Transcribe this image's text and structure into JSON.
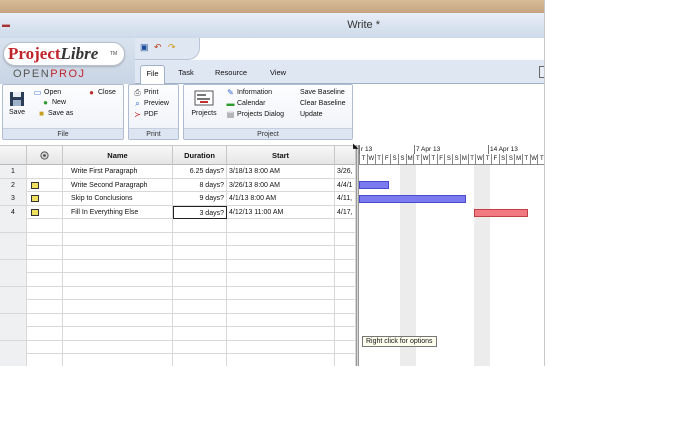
{
  "window": {
    "title": "Write *"
  },
  "logo": {
    "brand_project": "Project",
    "brand_libre": "Libre",
    "trademark": "TM",
    "openproj_open": "OPEN",
    "openproj_proj": "PROJ"
  },
  "tabs": [
    {
      "label": "File",
      "active": true
    },
    {
      "label": "Task",
      "active": false
    },
    {
      "label": "Resource",
      "active": false
    },
    {
      "label": "View",
      "active": false
    }
  ],
  "ribbon": {
    "file": {
      "caption": "File",
      "save": "Save",
      "open": "Open",
      "close": "Close",
      "new": "New",
      "save_as": "Save as"
    },
    "print": {
      "caption": "Print",
      "print": "Print",
      "preview": "Preview",
      "pdf": "PDF"
    },
    "project": {
      "caption": "Project",
      "projects": "Projects",
      "information": "Information",
      "calendar": "Calendar",
      "projects_dialog": "Projects Dialog",
      "save_baseline": "Save Baseline",
      "clear_baseline": "Clear Baseline",
      "update": "Update"
    }
  },
  "grid": {
    "headers": {
      "info": "",
      "name": "Name",
      "duration": "Duration",
      "start": "Start"
    },
    "rows": [
      {
        "num": "1",
        "note": false,
        "name": "Write First Paragraph",
        "duration": "6.25 days?",
        "start": "3/18/13 8:00 AM",
        "finish": "3/26,"
      },
      {
        "num": "2",
        "note": true,
        "name": "Write Second Paragraph",
        "duration": "8 days?",
        "start": "3/26/13 8:00 AM",
        "finish": "4/4/1"
      },
      {
        "num": "3",
        "note": true,
        "name": "Skip to Conclusions",
        "duration": "9 days?",
        "start": "4/1/13 8:00 AM",
        "finish": "4/11,"
      },
      {
        "num": "4",
        "note": true,
        "name": "Fill In Everything Else",
        "duration": "3 days?",
        "start": "4/12/13 11:00 AM",
        "finish": "4/17,"
      }
    ]
  },
  "gantt": {
    "weeks": [
      "r 13",
      "7 Apr 13",
      "14 Apr 13"
    ],
    "days": [
      "T",
      "W",
      "T",
      "F",
      "S",
      "S",
      "M",
      "T",
      "W",
      "T",
      "F",
      "S",
      "S",
      "M",
      "T",
      "W",
      "T",
      "F",
      "S",
      "S",
      "M",
      "T",
      "W",
      "T"
    ],
    "tooltip": "Right click for options",
    "colors": {
      "normal_bar": "#7b7bef",
      "critical_bar": "#f07a80"
    }
  }
}
